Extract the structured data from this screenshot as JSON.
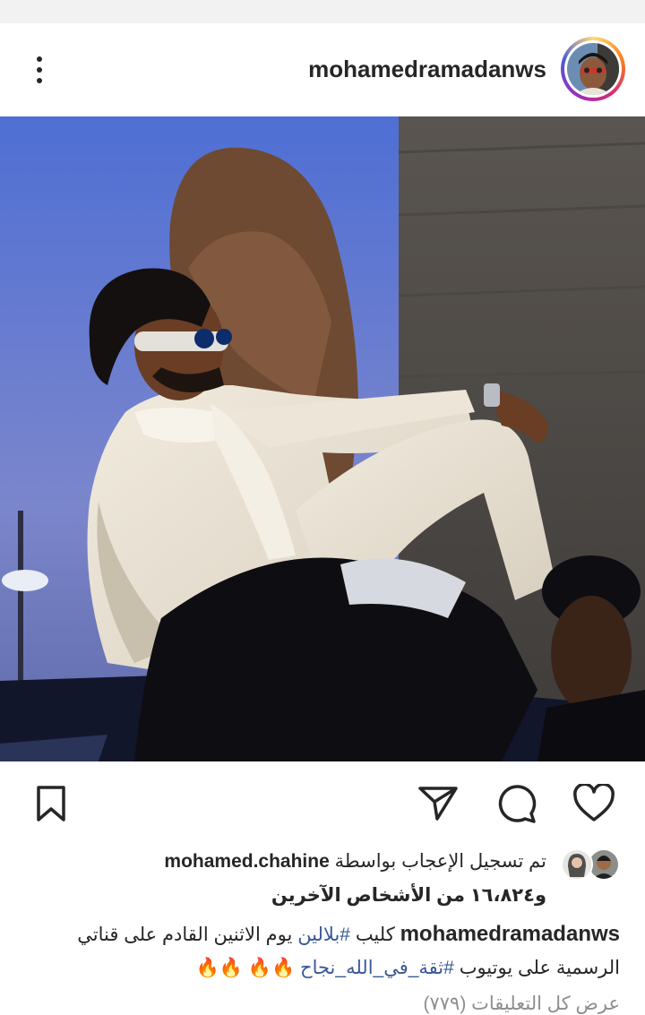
{
  "post": {
    "username": "mohamedramadanws",
    "more_icon": "more-vertical-icon"
  },
  "actions": {
    "bookmark_icon": "bookmark-icon",
    "share_icon": "send-icon",
    "comment_icon": "comment-icon",
    "like_icon": "heart-icon"
  },
  "likes": {
    "prefix": "تم تسجيل الإعجاب بواسطة",
    "liked_by": "mohamed.chahine",
    "and_others": "و١٦،٨٢٤ من الأشخاص الآخرين"
  },
  "caption": {
    "username": "mohamedramadanws",
    "text_1": "كليب",
    "tag_1": "#بلالين",
    "text_2": "يوم الاثنين القادم على قناتي الرسمية على يوتيوب",
    "tag_2": "#ثقة_في_الله_نجاح",
    "emoji": "🔥🔥 🔥🔥"
  },
  "comments": {
    "view_all": "عرض كل التعليقات (٧٧٩)"
  },
  "colors": {
    "link": "#385898",
    "muted": "#8e8e8e",
    "text": "#262626"
  }
}
